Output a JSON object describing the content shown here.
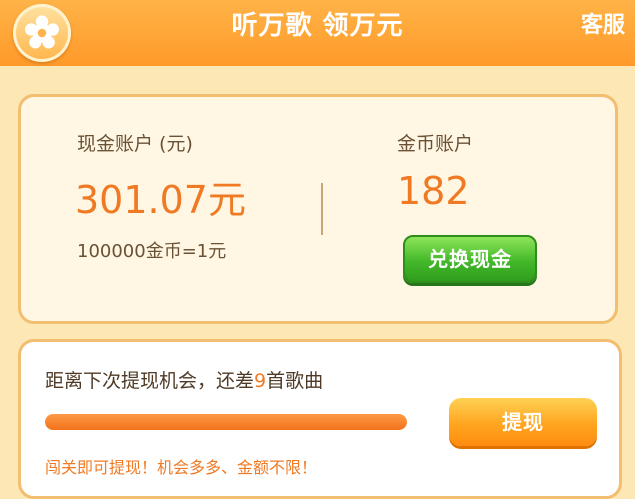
{
  "header": {
    "title": "听万歌 领万元",
    "service_label": "客服",
    "settings_icon": "settings-icon"
  },
  "account": {
    "cash_label": "现金账户 (元)",
    "cash_amount": "301.07元",
    "rate_text": "100000金币=1元",
    "coin_label": "金币账户",
    "coin_amount": "182",
    "exchange_button": "兑换现金"
  },
  "withdraw": {
    "remain_prefix": "距离下次提现机会，还差",
    "remain_count": "9",
    "remain_suffix": "首歌曲",
    "progress_fraction": 1.0,
    "button_label": "提现",
    "tip": "闯关即可提现！机会多多、金额不限！"
  },
  "colors": {
    "accent": "#f07a24",
    "header": "#ff9a2a",
    "exchange_green": "#44b82a",
    "withdraw_orange": "#ffa51f"
  }
}
